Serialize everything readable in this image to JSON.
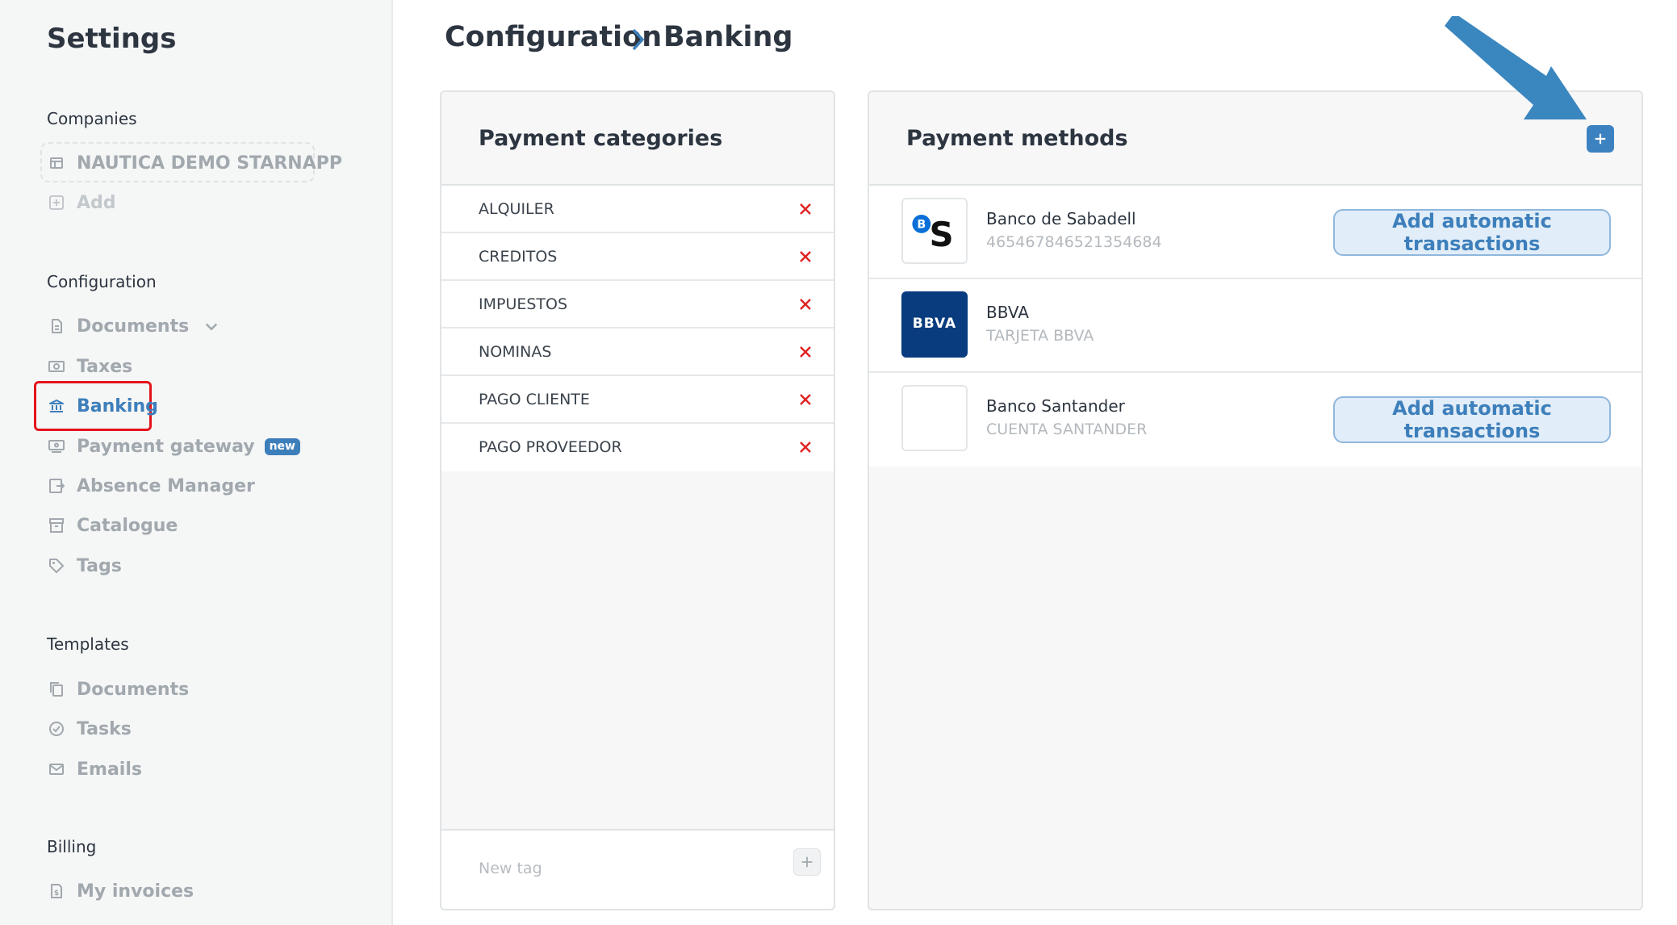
{
  "sidebar": {
    "title": "Settings",
    "companies": {
      "heading": "Companies",
      "company_name": "NAUTICA DEMO STARNAPP",
      "add_label": "Add"
    },
    "configuration": {
      "heading": "Configuration",
      "items": [
        {
          "label": "Documents",
          "icon": "document-icon"
        },
        {
          "label": "Taxes",
          "icon": "taxes-icon"
        },
        {
          "label": "Banking",
          "icon": "bank-icon",
          "active": true
        },
        {
          "label": "Payment gateway",
          "icon": "payment-gateway-icon",
          "badge": "new"
        },
        {
          "label": "Absence Manager",
          "icon": "absence-icon"
        },
        {
          "label": "Catalogue",
          "icon": "catalogue-icon"
        },
        {
          "label": "Tags",
          "icon": "tag-icon"
        }
      ]
    },
    "templates": {
      "heading": "Templates",
      "items": [
        {
          "label": "Documents",
          "icon": "copy-icon"
        },
        {
          "label": "Tasks",
          "icon": "check-circle-icon"
        },
        {
          "label": "Emails",
          "icon": "mail-icon"
        }
      ]
    },
    "billing": {
      "heading": "Billing",
      "items": [
        {
          "label": "My invoices",
          "icon": "invoice-icon"
        }
      ]
    }
  },
  "breadcrumb": {
    "parent": "Configuration",
    "current": "Banking"
  },
  "payment_categories": {
    "title": "Payment categories",
    "items": [
      "ALQUILER",
      "CREDITOS",
      "IMPUESTOS",
      "NOMINAS",
      "PAGO CLIENTE",
      "PAGO PROVEEDOR"
    ],
    "new_tag_placeholder": "New tag"
  },
  "payment_methods": {
    "title": "Payment methods",
    "items": [
      {
        "name": "Banco de Sabadell",
        "detail": "465467846521354684",
        "action": "Add automatic transactions",
        "logo": "sabadell-logo"
      },
      {
        "name": "BBVA",
        "detail": "TARJETA BBVA",
        "logo": "bbva-logo",
        "logo_text": "BBVA"
      },
      {
        "name": "Banco Santander",
        "detail": "CUENTA SANTANDER",
        "action": "Add automatic transactions",
        "logo": "blank-logo"
      }
    ]
  },
  "colors": {
    "accent": "#3d7fbb",
    "highlight_box": "#e5141c",
    "annotation_arrow": "#3a86bf",
    "delete_x": "#e02424"
  }
}
